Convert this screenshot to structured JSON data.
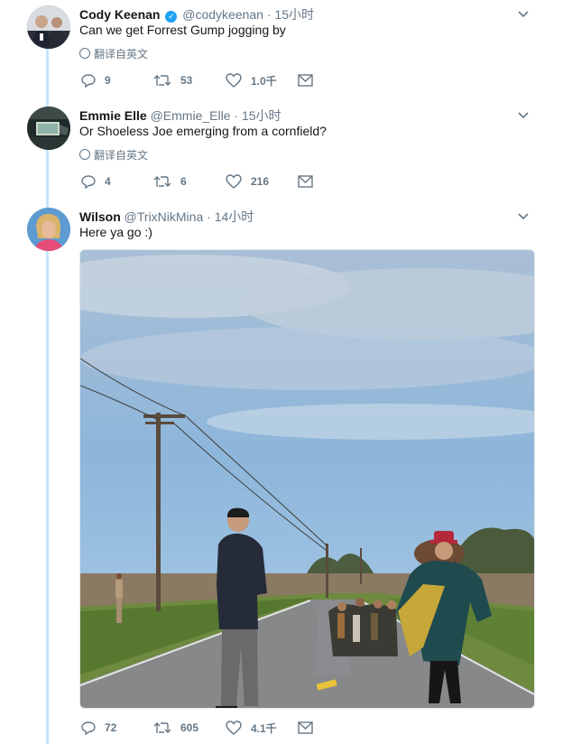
{
  "tweets": [
    {
      "name": "Cody Keenan",
      "handle": "@codykeenan",
      "time": "· 15小时",
      "text": "Can we get Forrest Gump jogging by",
      "translate": "翻译自英文",
      "verified": true,
      "reply_count": "9",
      "retweet_count": "53",
      "like_count": "1.0千"
    },
    {
      "name": "Emmie Elle",
      "handle": "@Emmie_Elle",
      "time": "· 15小时",
      "text": "Or Shoeless Joe emerging from a cornfield?",
      "translate": "翻译自英文",
      "reply_count": "4",
      "retweet_count": "6",
      "like_count": "216"
    },
    {
      "name": "Wilson",
      "handle": "@TrixNikMina",
      "time": "· 14小时",
      "text": "Here ya go :)",
      "reply_count": "72",
      "retweet_count": "605",
      "like_count": "4.1千"
    }
  ],
  "colors": {
    "thread_line": "#c4e4fb",
    "action_gray": "#657786",
    "verified_blue": "#1da1f2"
  },
  "icons": [
    "reply-icon",
    "retweet-icon",
    "like-icon",
    "message-icon",
    "globe-icon",
    "chevron-down-icon",
    "verified-icon"
  ]
}
